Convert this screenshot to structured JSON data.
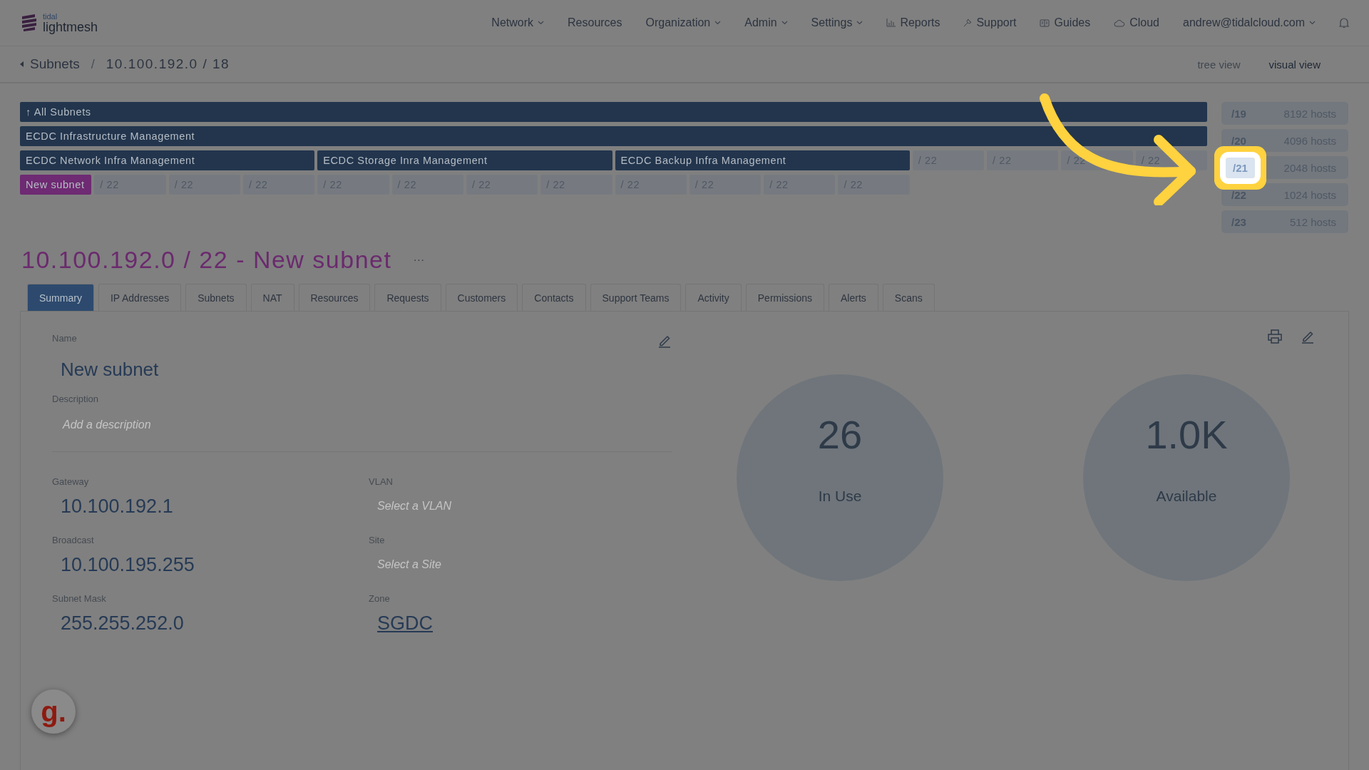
{
  "brand": {
    "small": "tidal",
    "name": "lightmesh"
  },
  "nav": [
    {
      "label": "Network",
      "has_menu": true
    },
    {
      "label": "Resources",
      "has_menu": false
    },
    {
      "label": "Organization",
      "has_menu": true
    },
    {
      "label": "Admin",
      "has_menu": true
    },
    {
      "label": "Settings",
      "has_menu": true
    },
    {
      "label": "Reports",
      "has_menu": false
    },
    {
      "label": "Support",
      "has_menu": false
    },
    {
      "label": "Guides",
      "has_menu": false
    },
    {
      "label": "Cloud",
      "has_menu": false
    },
    {
      "label": "andrew@tidalcloud.com",
      "has_menu": true
    }
  ],
  "breadcrumb": {
    "parent": "Subnets",
    "separator": "/",
    "current": "10.100.192.0 / 18"
  },
  "views": [
    {
      "label": "tree view",
      "selected": false
    },
    {
      "label": "visual view",
      "selected": true
    }
  ],
  "subnet_rows": [
    [
      {
        "label": "↑ All Subnets",
        "kind": "parent"
      }
    ],
    [
      {
        "label": "ECDC Infrastructure Management",
        "kind": "parent"
      }
    ],
    [
      {
        "label": "ECDC Network Infra Management",
        "kind": "named"
      },
      {
        "label": "ECDC Storage Inra Management",
        "kind": "named"
      },
      {
        "label": "ECDC Backup Infra Management",
        "kind": "named"
      },
      {
        "label": "/ 22",
        "kind": "free"
      },
      {
        "label": "/ 22",
        "kind": "free"
      },
      {
        "label": "/ 22",
        "kind": "free"
      },
      {
        "label": "/ 22",
        "kind": "free"
      }
    ],
    [
      {
        "label": "New subnet",
        "kind": "current"
      },
      {
        "label": "/ 22",
        "kind": "free"
      },
      {
        "label": "/ 22",
        "kind": "free"
      },
      {
        "label": "/ 22",
        "kind": "free"
      },
      {
        "label": "/ 22",
        "kind": "free"
      },
      {
        "label": "/ 22",
        "kind": "free"
      },
      {
        "label": "/ 22",
        "kind": "free"
      },
      {
        "label": "/ 22",
        "kind": "free"
      },
      {
        "label": "/ 22",
        "kind": "free"
      },
      {
        "label": "/ 22",
        "kind": "free"
      },
      {
        "label": "/ 22",
        "kind": "free"
      },
      {
        "label": "/ 22",
        "kind": "free"
      }
    ]
  ],
  "host_sizes": [
    {
      "prefix": "/19",
      "hosts": "8192 hosts",
      "highlighted": false
    },
    {
      "prefix": "/20",
      "hosts": "4096 hosts",
      "highlighted": false
    },
    {
      "prefix": "/21",
      "hosts": "2048 hosts",
      "highlighted": true
    },
    {
      "prefix": "/22",
      "hosts": "1024 hosts",
      "highlighted": false
    },
    {
      "prefix": "/23",
      "hosts": "512 hosts",
      "highlighted": false
    }
  ],
  "title": "10.100.192.0 / 22 - New subnet",
  "title_menu": "···",
  "tabs": [
    {
      "label": "Summary",
      "selected": true
    },
    {
      "label": "IP Addresses",
      "selected": false
    },
    {
      "label": "Subnets",
      "selected": false
    },
    {
      "label": "NAT",
      "selected": false
    },
    {
      "label": "Resources",
      "selected": false
    },
    {
      "label": "Requests",
      "selected": false
    },
    {
      "label": "Customers",
      "selected": false
    },
    {
      "label": "Contacts",
      "selected": false
    },
    {
      "label": "Support Teams",
      "selected": false
    },
    {
      "label": "Activity",
      "selected": false
    },
    {
      "label": "Permissions",
      "selected": false
    },
    {
      "label": "Alerts",
      "selected": false
    },
    {
      "label": "Scans",
      "selected": false
    }
  ],
  "name": {
    "label": "Name",
    "value": "New subnet"
  },
  "description": {
    "label": "Description",
    "placeholder": "Add a description"
  },
  "fields": [
    {
      "label": "Gateway",
      "value": "10.100.192.1",
      "kind": "value"
    },
    {
      "label": "VLAN",
      "placeholder": "Select a VLAN",
      "kind": "select"
    },
    {
      "label": "Broadcast",
      "value": "10.100.195.255",
      "kind": "value"
    },
    {
      "label": "Site",
      "placeholder": "Select a Site",
      "kind": "select"
    },
    {
      "label": "Subnet Mask",
      "value": "255.255.252.0",
      "kind": "value"
    },
    {
      "label": "Zone",
      "value": "SGDC",
      "kind": "link"
    }
  ],
  "stats": [
    {
      "value": "26",
      "label": "In Use"
    },
    {
      "value": "1.0K",
      "label": "Available"
    }
  ],
  "widget": "g."
}
